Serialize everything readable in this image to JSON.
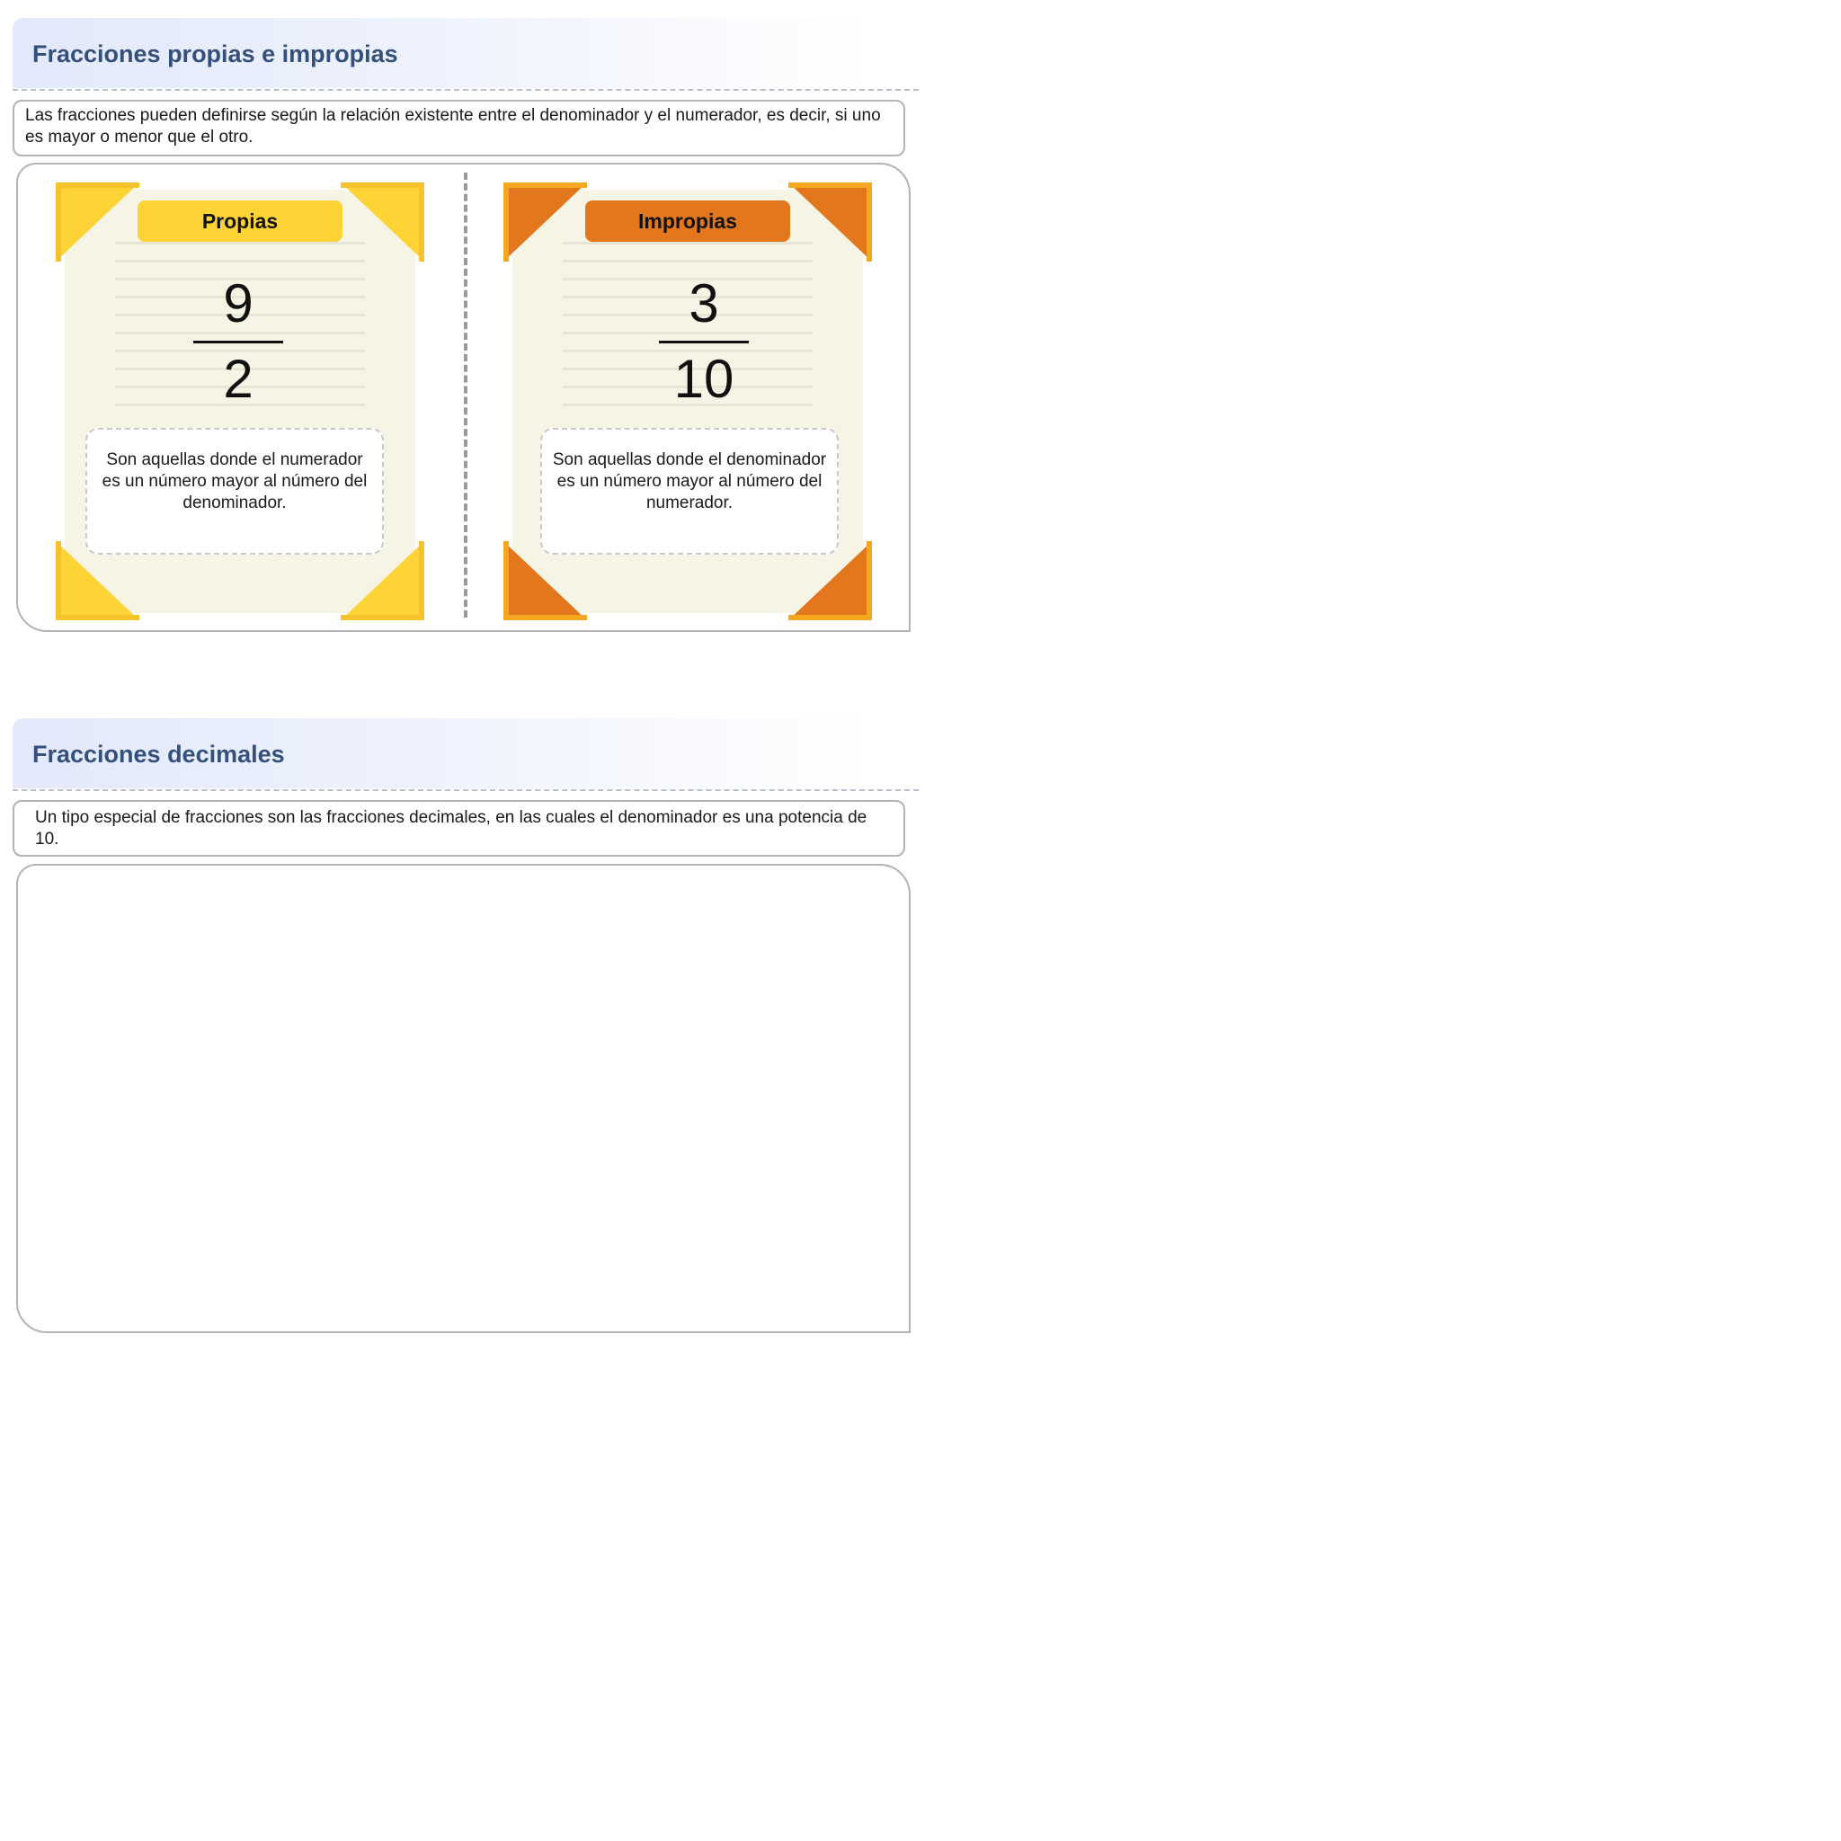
{
  "section1": {
    "title": "Fracciones propias e impropias",
    "description": "Las fracciones pueden definirse según la relación existente entre el denominador y el numerador, es decir, si uno es mayor o menor que el otro.",
    "cards": [
      {
        "label": "Propias",
        "numerator": "9",
        "denominator": "2",
        "definition": "Son aquellas donde el numerador es un número mayor al número del denominador.",
        "accent_color": "#fed336"
      },
      {
        "label": "Impropias",
        "numerator": "3",
        "denominator": "10",
        "definition": "Son aquellas donde el denominador es un número mayor al número del numerador.",
        "accent_color": "#e2771e"
      }
    ]
  },
  "section2": {
    "title": "Fracciones decimales",
    "description": "Un tipo especial de fracciones son las fracciones decimales, en las cuales el denominador es una potencia de 10."
  },
  "colors": {
    "title_text": "#34507c",
    "header_gradient_start": "#e3e9fb",
    "border": "#b3b3b3",
    "paper": "#f6f4e4"
  }
}
